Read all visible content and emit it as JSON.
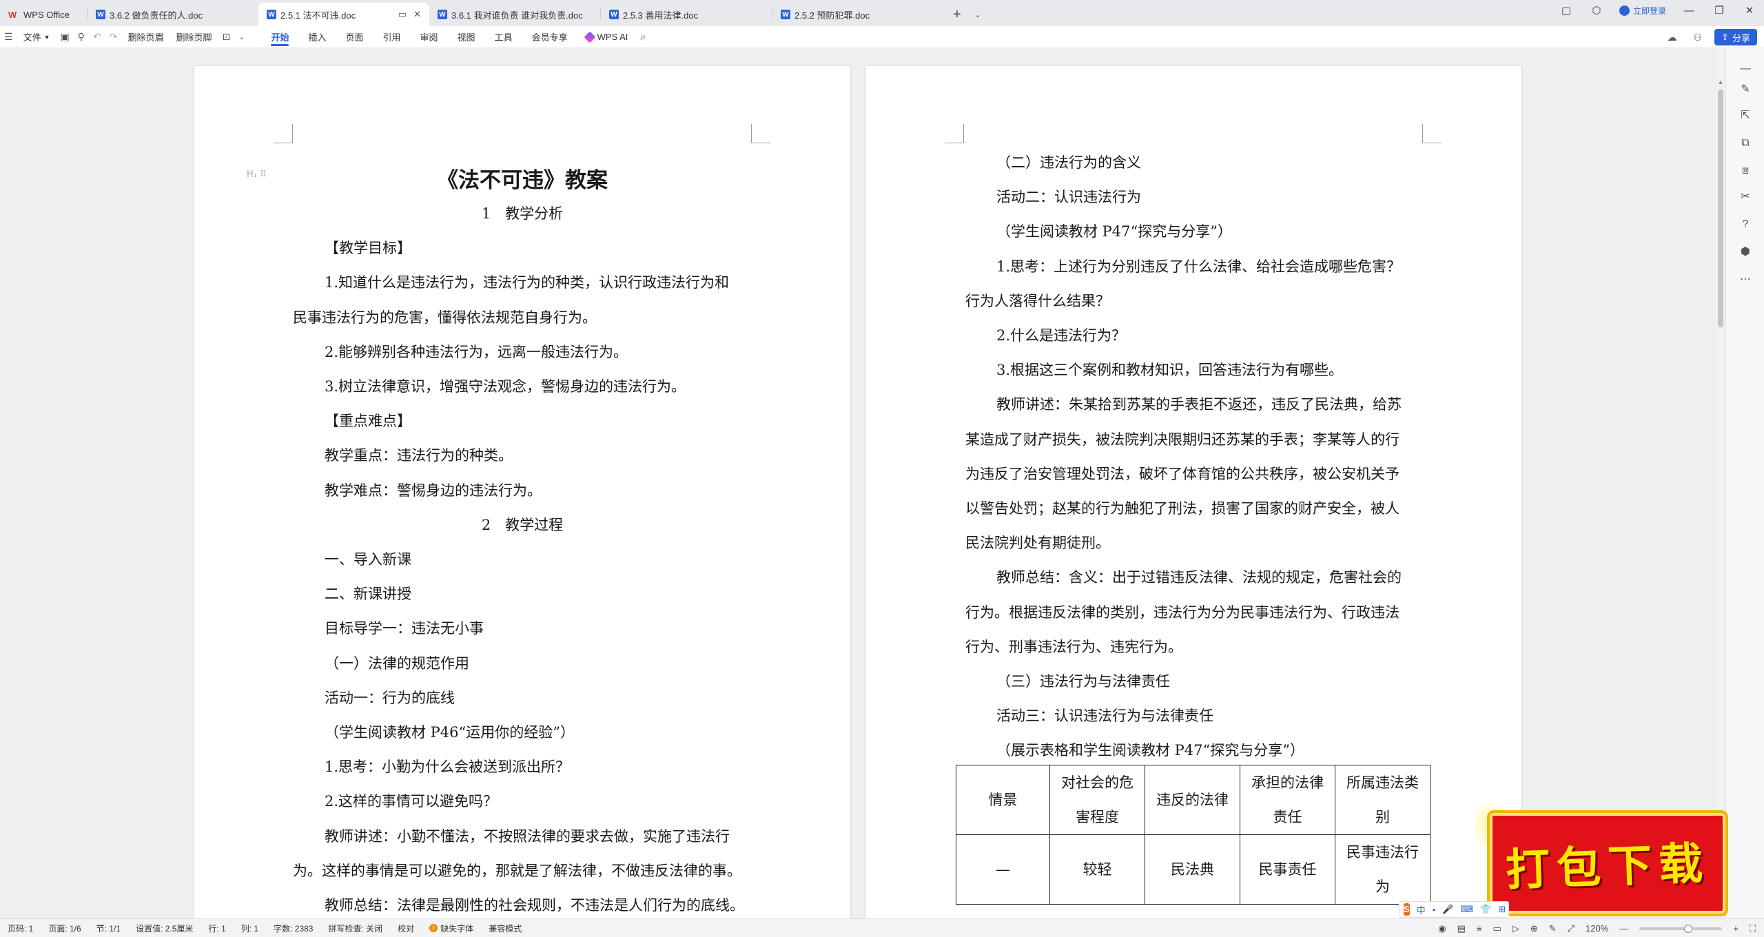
{
  "tabs": [
    {
      "label": "WPS Office",
      "kind": "home"
    },
    {
      "label": "3.6.2 做负责任的人.doc",
      "kind": "doc"
    },
    {
      "label": "2.5.1 法不可违.doc",
      "kind": "doc",
      "active": true
    },
    {
      "label": "3.6.1 我对谁负责 谁对我负责.doc",
      "kind": "doc"
    },
    {
      "label": "2.5.3 善用法律.doc",
      "kind": "doc"
    },
    {
      "label": "2.5.2 预防犯罪.doc",
      "kind": "doc"
    }
  ],
  "tabbar": {
    "add_label": "+",
    "login_label": "立即登录"
  },
  "toolbar": {
    "file_label": "文件",
    "delete_header_label": "删除页眉",
    "delete_footer_label": "删除页脚",
    "menu_tabs": [
      "开始",
      "插入",
      "页面",
      "引用",
      "审阅",
      "视图",
      "工具",
      "会员专享"
    ],
    "active_tab": "开始",
    "ai_label": "WPS AI",
    "share_label": "分享"
  },
  "page1": {
    "title": "《法不可违》教案",
    "lines": [
      {
        "text": "1　教学分析",
        "style": "center"
      },
      {
        "text": "【教学目标】",
        "style": "indent"
      },
      {
        "text": "1.知道什么是违法行为，违法行为的种类，认识行政违法行为和",
        "style": "indent"
      },
      {
        "text": "民事违法行为的危害，懂得依法规范自身行为。",
        "style": "plain"
      },
      {
        "text": "2.能够辨别各种违法行为，远离一般违法行为。",
        "style": "indent"
      },
      {
        "text": "3.树立法律意识，增强守法观念，警惕身边的违法行为。",
        "style": "indent"
      },
      {
        "text": "【重点难点】",
        "style": "indent"
      },
      {
        "text": "教学重点：违法行为的种类。",
        "style": "indent"
      },
      {
        "text": "教学难点：警惕身边的违法行为。",
        "style": "indent"
      },
      {
        "text": "2　教学过程",
        "style": "center"
      },
      {
        "text": "一、导入新课",
        "style": "indent"
      },
      {
        "text": "二、新课讲授",
        "style": "indent"
      },
      {
        "text": "目标导学一：违法无小事",
        "style": "indent"
      },
      {
        "text": "（一）法律的规范作用",
        "style": "indent"
      },
      {
        "text": "活动一：行为的底线",
        "style": "indent"
      },
      {
        "text": "（学生阅读教材 P46“运用你的经验”）",
        "style": "indent"
      },
      {
        "text": "1.思考：小勤为什么会被送到派出所？",
        "style": "indent"
      },
      {
        "text": "2.这样的事情可以避免吗？",
        "style": "indent"
      },
      {
        "text": "教师讲述：小勤不懂法，不按照法律的要求去做，实施了违法行",
        "style": "indent"
      },
      {
        "text": "为。这样的事情是可以避免的，那就是了解法律，不做违反法律的事。",
        "style": "plain"
      },
      {
        "text": "教师总结：法律是最刚性的社会规则，不违法是人们行为的底线。",
        "style": "indent"
      }
    ]
  },
  "page2": {
    "lines": [
      {
        "text": "（二）违法行为的含义",
        "style": "indent"
      },
      {
        "text": "活动二：认识违法行为",
        "style": "indent"
      },
      {
        "text": "（学生阅读教材 P47“探究与分享”）",
        "style": "indent"
      },
      {
        "text": "1.思考：上述行为分别违反了什么法律、给社会造成哪些危害？",
        "style": "indent"
      },
      {
        "text": "行为人落得什么结果？",
        "style": "plain"
      },
      {
        "text": "2.什么是违法行为？",
        "style": "indent"
      },
      {
        "text": "3.根据这三个案例和教材知识，回答违法行为有哪些。",
        "style": "indent"
      },
      {
        "text": "教师讲述：朱某拾到苏某的手表拒不返还，违反了民法典，给苏",
        "style": "indent"
      },
      {
        "text": "某造成了财产损失，被法院判决限期归还苏某的手表；李某等人的行",
        "style": "plain"
      },
      {
        "text": "为违反了治安管理处罚法，破坏了体育馆的公共秩序，被公安机关予",
        "style": "plain"
      },
      {
        "text": "以警告处罚；赵某的行为触犯了刑法，损害了国家的财产安全，被人",
        "style": "plain"
      },
      {
        "text": "民法院判处有期徒刑。",
        "style": "plain"
      },
      {
        "text": "教师总结：含义：出于过错违反法律、法规的规定，危害社会的",
        "style": "indent"
      },
      {
        "text": "行为。根据违反法律的类别，违法行为分为民事违法行为、行政违法",
        "style": "plain"
      },
      {
        "text": "行为、刑事违法行为、违宪行为。",
        "style": "plain"
      },
      {
        "text": "（三）违法行为与法律责任",
        "style": "indent"
      },
      {
        "text": "活动三：认识违法行为与法律责任",
        "style": "indent"
      },
      {
        "text": "（展示表格和学生阅读教材 P47“探究与分享”）",
        "style": "indent"
      }
    ],
    "table": {
      "header": [
        [
          "情景"
        ],
        [
          "对社会的危",
          "害程度"
        ],
        [
          "违反的法律"
        ],
        [
          "承担的法律",
          "责任"
        ],
        [
          "所属违法类",
          "别"
        ]
      ],
      "rows": [
        [
          [
            "—"
          ],
          [
            "较轻"
          ],
          [
            "民法典"
          ],
          [
            "民事责任"
          ],
          [
            "民事违法行",
            "为"
          ]
        ]
      ]
    }
  },
  "promo": {
    "text": "打包下载"
  },
  "statusbar": {
    "items": [
      "页码: 1",
      "页面: 1/6",
      "节: 1/1",
      "设置值: 2.5厘米",
      "行: 1",
      "列: 1",
      "字数: 2383",
      "拼写检查: 关闭",
      "校对",
      "缺失字体",
      "兼容模式"
    ],
    "zoom_label": "120%",
    "zoom_level": 0.6
  },
  "ime": {
    "logo": "S",
    "mode": "中"
  },
  "colors": {
    "accent": "#2b62d9",
    "promo_red": "#e01217",
    "promo_yellow": "#ffe600",
    "wps_red": "#e8332c"
  }
}
